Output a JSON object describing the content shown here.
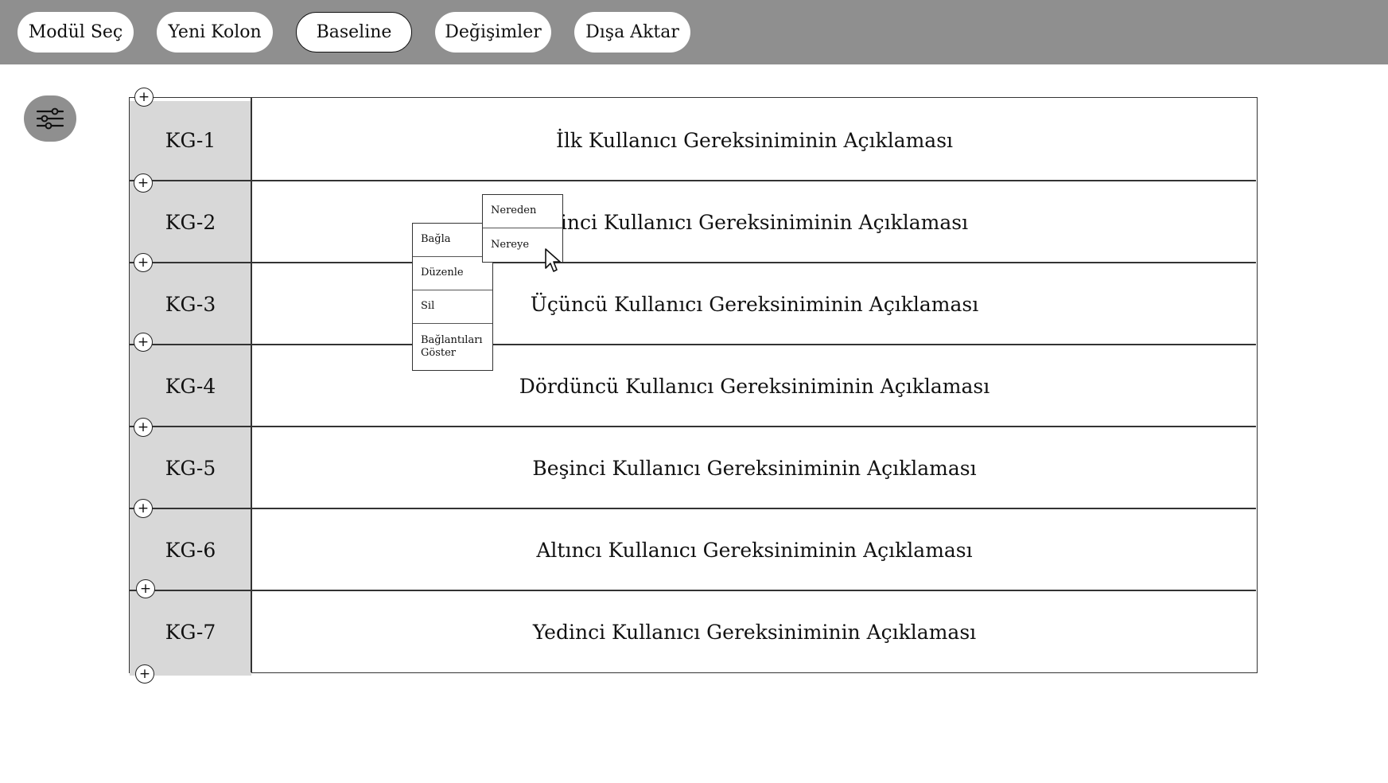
{
  "toolbar": {
    "buttons": [
      {
        "label": "Modül Seç"
      },
      {
        "label": "Yeni Kolon"
      },
      {
        "label": "Baseline"
      },
      {
        "label": "Değişimler"
      },
      {
        "label": "Dışa Aktar"
      }
    ],
    "active": "Baseline"
  },
  "filter_icon": "sliders-icon",
  "rows": [
    {
      "id": "KG-1",
      "description": "İlk Kullanıcı Gereksiniminin Açıklaması"
    },
    {
      "id": "KG-2",
      "description": "İkinci Kullanıcı Gereksiniminin Açıklaması"
    },
    {
      "id": "KG-3",
      "description": "Üçüncü Kullanıcı Gereksiniminin Açıklaması"
    },
    {
      "id": "KG-4",
      "description": "Dördüncü Kullanıcı Gereksiniminin Açıklaması"
    },
    {
      "id": "KG-5",
      "description": "Beşinci Kullanıcı Gereksiniminin Açıklaması"
    },
    {
      "id": "KG-6",
      "description": "Altıncı Kullanıcı Gereksiniminin Açıklaması"
    },
    {
      "id": "KG-7",
      "description": "Yedinci Kullanıcı Gereksiniminin Açıklaması"
    }
  ],
  "add_row_icon": "plus-circle-icon",
  "context_menu": {
    "items": [
      "Bağla",
      "Düzenle",
      "Sil",
      "Bağlantıları Göster"
    ]
  },
  "submenu": {
    "items": [
      "Nereden",
      "Nereye"
    ]
  },
  "colors": {
    "toolbar_bg": "#8f8f8f",
    "id_column_bg": "#d8d8d8",
    "border": "#333333"
  }
}
